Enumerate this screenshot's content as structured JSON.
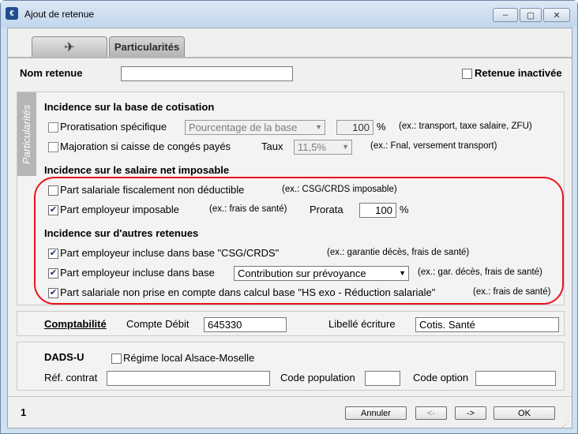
{
  "window": {
    "title": "Ajout de retenue",
    "app_icon": "€",
    "min": "–",
    "max": "▢",
    "close": "✕"
  },
  "tabs": [
    {
      "label": "✈"
    },
    {
      "label": "Particularités"
    }
  ],
  "header": {
    "nom_label": "Nom retenue",
    "nom_value": "",
    "inactive_label": "Retenue inactivée"
  },
  "side_label": "Particularités",
  "base_cotisation": {
    "title": "Incidence sur la base de cotisation",
    "proratisation": {
      "label": "Proratisation spécifique",
      "select": "Pourcentage de la base",
      "value": "100",
      "unit": "%",
      "example": "(ex.: transport, taxe salaire, ZFU)"
    },
    "majoration": {
      "label": "Majoration si caisse de congés payés",
      "taux_label": "Taux",
      "taux_value": "11,5%",
      "example": "(ex.: Fnal, versement transport)"
    }
  },
  "salaire_net": {
    "title": "Incidence sur le salaire net imposable",
    "part_salariale": {
      "label": "Part salariale fiscalement non déductible",
      "checked": false,
      "example": "(ex.: CSG/CRDS imposable)"
    },
    "part_employeur": {
      "label": "Part employeur imposable",
      "checked": true,
      "example": "(ex.: frais de santé)",
      "prorata_label": "Prorata",
      "prorata_value": "100",
      "unit": "%"
    }
  },
  "autres_retenues": {
    "title": "Incidence sur d'autres retenues",
    "row1": {
      "label": "Part employeur incluse dans base \"CSG/CRDS\"",
      "checked": true,
      "example": "(ex.: garantie décès, frais de santé)"
    },
    "row2": {
      "label": "Part employeur incluse dans base",
      "checked": true,
      "select": "Contribution sur prévoyance",
      "example": "(ex.: gar. décès, frais de santé)"
    },
    "row3": {
      "label": "Part salariale non prise en compte dans calcul base \"HS exo - Réduction salariale\"",
      "checked": true,
      "example": "(ex.: frais de santé)"
    }
  },
  "comptabilite": {
    "title": "Comptabilité",
    "compte_label": "Compte Débit",
    "compte_value": "645330",
    "libelle_label": "Libellé écriture",
    "libelle_value": "Cotis. Santé"
  },
  "dadsu": {
    "title": "DADS-U",
    "regime_label": "Régime local Alsace-Moselle",
    "ref_label": "Réf. contrat",
    "ref_value": "",
    "code_pop_label": "Code population",
    "code_pop_value": "",
    "code_opt_label": "Code option",
    "code_opt_value": ""
  },
  "footer": {
    "page": "1",
    "annuler": "Annuler",
    "prev": "<-",
    "next": "->",
    "ok": "OK"
  },
  "colors": {
    "highlight": "#e8151b",
    "title_bar": "#c3d6ec",
    "side_tab": "#b5b5b5"
  }
}
